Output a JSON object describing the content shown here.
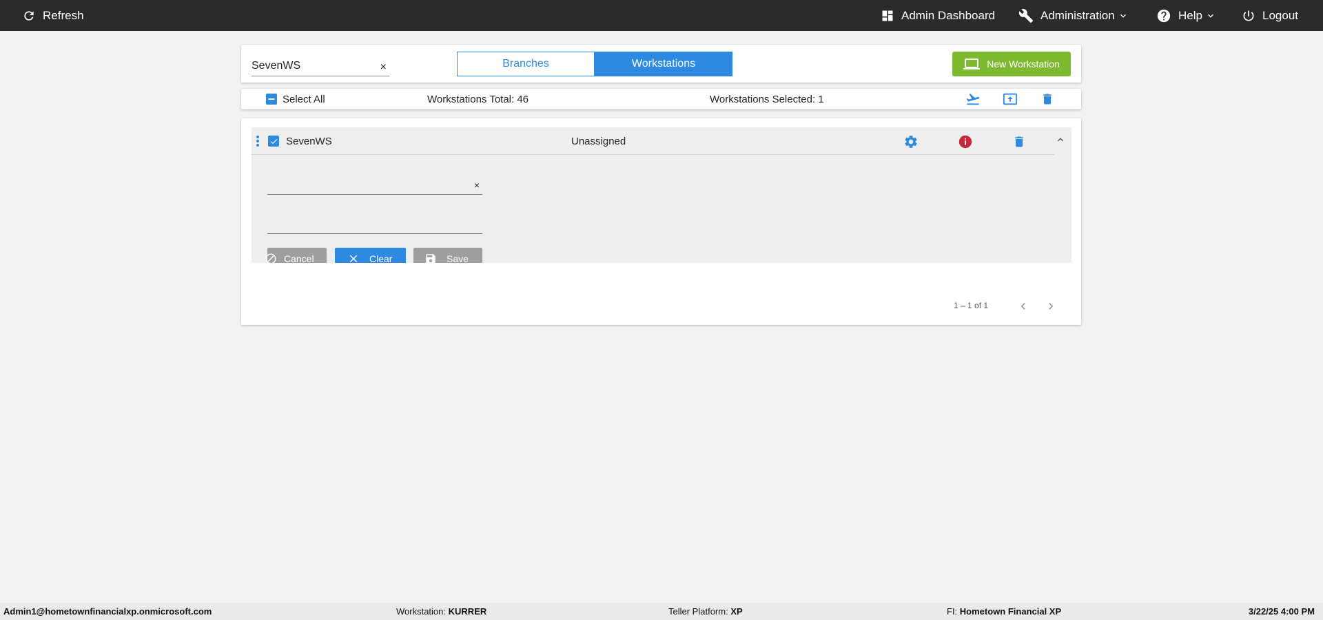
{
  "topbar": {
    "refresh": "Refresh",
    "admin_dashboard": "Admin Dashboard",
    "administration": "Administration",
    "help": "Help",
    "logout": "Logout"
  },
  "search": {
    "value": "SevenWS",
    "clear": "×"
  },
  "view_toggle": {
    "branches": "Branches",
    "workstations": "Workstations",
    "selected": "Workstations"
  },
  "new_workstation_button": "New Workstation",
  "selection_bar": {
    "select_all": "Select All",
    "total_label": "Workstations Total: 46",
    "selected_label": "Workstations Selected: 1"
  },
  "workstation_row": {
    "name": "SevenWS",
    "status": "Unassigned",
    "checked": true,
    "branch_field": {
      "value": "",
      "clear": "×"
    },
    "notes_field": {
      "value": ""
    },
    "cancel_label": "Cancel",
    "clear_label": "Clear",
    "save_label": "Save"
  },
  "pagination": {
    "range": "1 – 1 of 1"
  },
  "footer": {
    "user": "Admin1@hometownfinancialxp.onmicrosoft.com",
    "workstation_label": "Workstation:",
    "workstation_value": "KURRER",
    "platform_label": "Teller Platform:",
    "platform_value": "XP",
    "fi_label": "FI:",
    "fi_value": "Hometown Financial XP",
    "datetime": "3/22/25 4:00 PM"
  },
  "colors": {
    "accent": "#2e8ae0",
    "new_button": "#7dba2f",
    "info_icon": "#c62839",
    "topbar": "#2b2b2b"
  }
}
